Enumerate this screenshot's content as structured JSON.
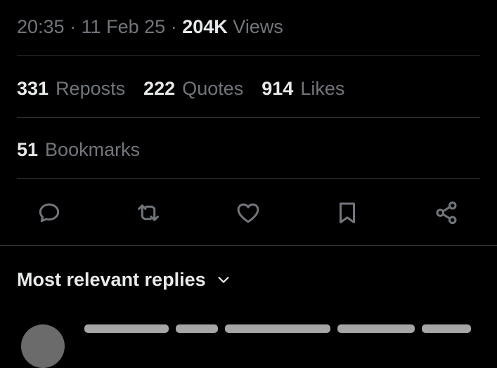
{
  "tweet": {
    "time": "20:35",
    "date": "11 Feb 25",
    "separator": "·",
    "views_count": "204K",
    "views_label": "Views"
  },
  "stats": [
    {
      "num": "331",
      "label": "Reposts"
    },
    {
      "num": "222",
      "label": "Quotes"
    },
    {
      "num": "914",
      "label": "Likes"
    }
  ],
  "bookmarks": {
    "num": "51",
    "label": "Bookmarks"
  },
  "actions": {
    "reply_icon": "reply-icon",
    "repost_icon": "repost-icon",
    "like_icon": "heart-icon",
    "bookmark_icon": "bookmark-icon",
    "share_icon": "share-icon"
  },
  "replies": {
    "sort_label": "Most relevant replies"
  },
  "colors": {
    "background": "#000000",
    "primary_text": "#e7e9ea",
    "secondary_text": "#71767b",
    "divider": "#2f3336",
    "icon": "#71767b"
  }
}
